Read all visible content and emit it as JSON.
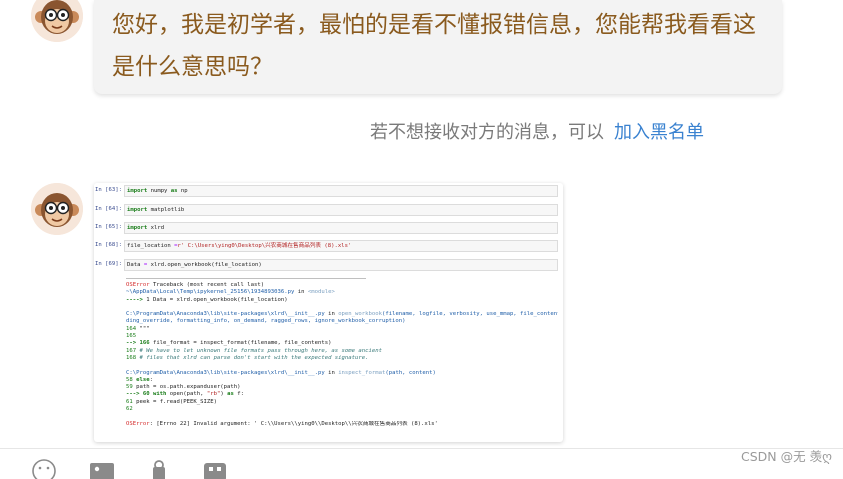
{
  "message": {
    "text": "您好，我是初学者，最怕的是看不懂报错信息，您能帮我看看这是什么意思吗？"
  },
  "system_note": {
    "text": "若不想接收对方的消息，可以",
    "link": "加入黑名单"
  },
  "screenshot": {
    "cells": [
      {
        "prompt": "In  [63]:",
        "parts": [
          [
            "kw",
            "import"
          ],
          [
            "",
            " numpy "
          ],
          [
            "kw",
            "as"
          ],
          [
            "",
            " np"
          ]
        ]
      },
      {
        "prompt": "In  [64]:",
        "parts": [
          [
            "kw",
            "import"
          ],
          [
            "",
            " matplotlib"
          ]
        ]
      },
      {
        "prompt": "In  [65]:",
        "parts": [
          [
            "kw",
            "import"
          ],
          [
            "",
            " xlrd"
          ]
        ]
      },
      {
        "prompt": "In  [68]:",
        "parts": [
          [
            "",
            "file_location "
          ],
          [
            "op",
            "="
          ],
          [
            "str",
            "r' C:\\Users\\ying0\\Desktop\\兴农商城在售商品列表 (8).xls'"
          ]
        ]
      },
      {
        "prompt": "In  [69]:",
        "parts": [
          [
            "",
            "Data "
          ],
          [
            "op",
            "="
          ],
          [
            "",
            " xlrd.open_workbook(file_location)"
          ]
        ]
      }
    ],
    "output_lines": [
      {
        "type": "rule"
      },
      {
        "parts": [
          [
            "err",
            "OSError"
          ],
          [
            "",
            "                                   Traceback (most recent call last)"
          ]
        ]
      },
      {
        "parts": [
          [
            "path",
            "~\\AppData\\Local\\Temp\\ipykernel_25156\\1934893036.py"
          ],
          [
            "",
            " in "
          ],
          [
            "muted",
            "<module>"
          ]
        ]
      },
      {
        "parts": [
          [
            "arrow",
            "---->"
          ],
          [
            "",
            " 1 Data = xlrd.open_workbook(file_location)"
          ]
        ]
      },
      {
        "type": "gap"
      },
      {
        "parts": [
          [
            "path",
            "C:\\ProgramData\\Anaconda3\\lib\\site-packages\\xlrd\\__init__.py"
          ],
          [
            "",
            " in "
          ],
          [
            "muted",
            "open_workbook"
          ],
          [
            "path",
            "(filename, logfile, verbosity, use_mmap, file_contents, enco"
          ]
        ]
      },
      {
        "parts": [
          [
            "path",
            "ding_override, formatting_info, on_demand, ragged_rows, ignore_workbook_corruption)"
          ]
        ]
      },
      {
        "parts": [
          [
            "lno",
            "    164"
          ],
          [
            "",
            "      \"\"\""
          ]
        ]
      },
      {
        "parts": [
          [
            "lno",
            "    165"
          ]
        ]
      },
      {
        "parts": [
          [
            "arrow",
            "--> 166"
          ],
          [
            "",
            "      file_format = inspect_format(filename, file_contents)"
          ]
        ]
      },
      {
        "parts": [
          [
            "lno",
            "    167"
          ],
          [
            "cmt",
            "      # We have to let unknown file formats pass through here, as some ancient"
          ]
        ]
      },
      {
        "parts": [
          [
            "lno",
            "    168"
          ],
          [
            "cmt",
            "      # files that xlrd can parse don't start with the expected signature."
          ]
        ]
      },
      {
        "type": "gap"
      },
      {
        "parts": [
          [
            "path",
            "C:\\ProgramData\\Anaconda3\\lib\\site-packages\\xlrd\\__init__.py"
          ],
          [
            "",
            " in "
          ],
          [
            "muted",
            "inspect_format"
          ],
          [
            "path",
            "(path, content)"
          ]
        ]
      },
      {
        "parts": [
          [
            "lno",
            "     58"
          ],
          [
            "kw",
            "      else"
          ],
          [
            "",
            ":"
          ]
        ]
      },
      {
        "parts": [
          [
            "lno",
            "     59"
          ],
          [
            "",
            "          path = os.path.expanduser(path)"
          ]
        ]
      },
      {
        "parts": [
          [
            "arrow",
            "---> 60"
          ],
          [
            "kw",
            "          with"
          ],
          [
            "",
            " open(path, "
          ],
          [
            "str",
            "\"rb\""
          ],
          [
            "",
            ") "
          ],
          [
            "kw",
            "as"
          ],
          [
            "",
            " f:"
          ]
        ]
      },
      {
        "parts": [
          [
            "lno",
            "     61"
          ],
          [
            "",
            "              peek = f.read(PEEK_SIZE)"
          ]
        ]
      },
      {
        "parts": [
          [
            "lno",
            "     62"
          ]
        ]
      },
      {
        "type": "gap"
      },
      {
        "parts": [
          [
            "err",
            "OSError"
          ],
          [
            "",
            ": [Errno 22] Invalid argument: ' C:\\\\Users\\\\ying0\\\\Desktop\\\\兴农商城在售商品列表 (8).xls'"
          ]
        ]
      }
    ]
  },
  "toolbar": {
    "icons": [
      "emoji-icon",
      "image-icon",
      "lock-icon",
      "cut-icon"
    ]
  },
  "watermark": {
    "text": "CSDN @无 羡ღ"
  },
  "colors": {
    "message_text": "#8a5a1e",
    "link": "#3a82d0",
    "bubble_bg": "#f3f3f3"
  }
}
